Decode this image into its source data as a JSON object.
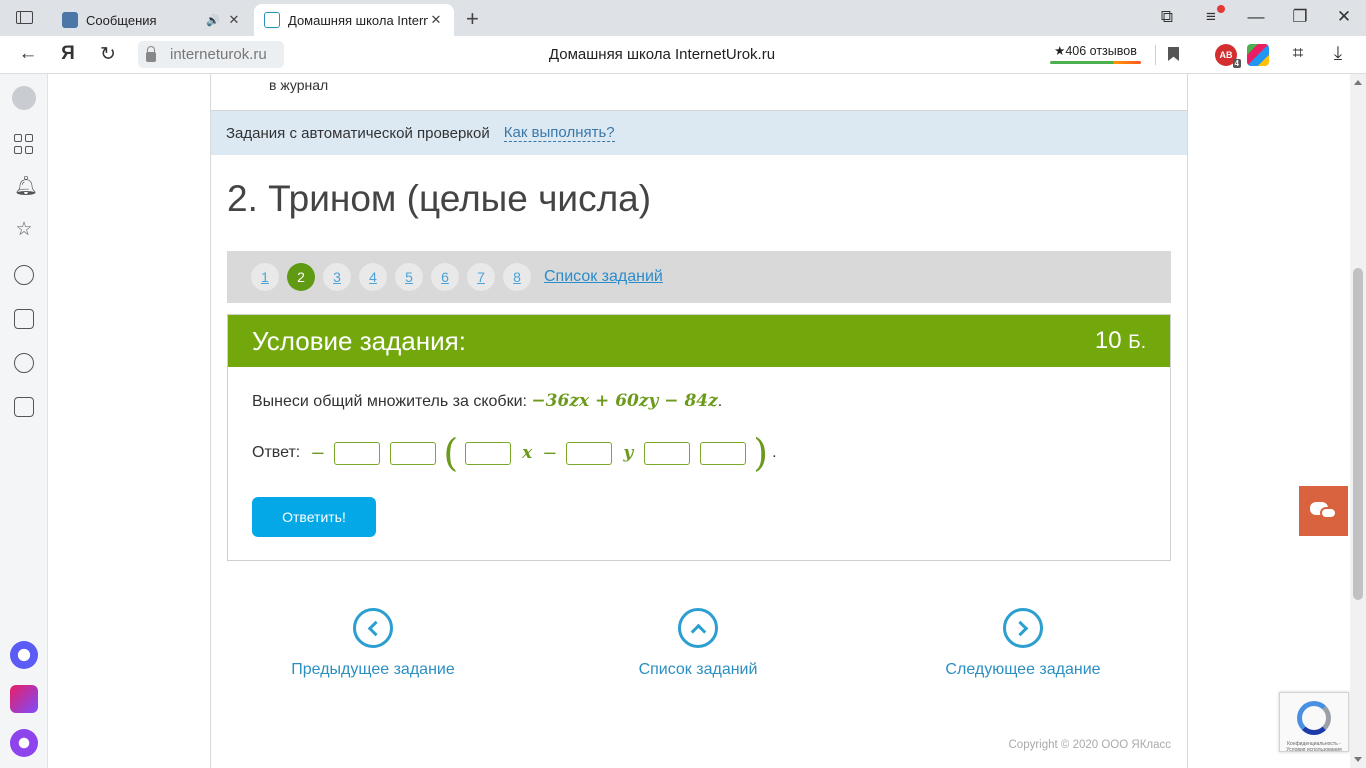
{
  "browser": {
    "tabs": [
      {
        "title": "Сообщения",
        "active": false,
        "playing_audio": true
      },
      {
        "title": "Домашняя школа Intern",
        "active": true,
        "playing_audio": false
      }
    ],
    "address": "interneturok.ru",
    "page_title": "Домашняя школа InternetUrok.ru",
    "reviews": "★406 отзывов",
    "yandex_letter": "Я",
    "extension_badge": "4"
  },
  "page": {
    "journal_text": "в журнал",
    "autocheck": {
      "label": "Задания с автоматической проверкой",
      "howto_link": "Как выполнять?"
    },
    "heading": "2. Трином (целые числа)",
    "pager": {
      "pages": [
        "1",
        "2",
        "3",
        "4",
        "5",
        "6",
        "7",
        "8"
      ],
      "active_index": 1,
      "list_link": "Список заданий"
    },
    "task": {
      "title": "Условие задания:",
      "points": "10",
      "points_unit": "Б.",
      "question": "Вынеси общий множитель за скобки: ",
      "expression": "−36zx + 60zy − 84z",
      "expression_end": ".",
      "answer_label": "Ответ:",
      "answer_minus": "−",
      "answer_var_x": "x",
      "answer_minus2": "−",
      "answer_var_y": "y",
      "answer_end": ".",
      "inputs": [
        "",
        "",
        "",
        "",
        "",
        ""
      ],
      "submit": "Ответить!"
    },
    "nav": {
      "prev": "Предыдущее задание",
      "list": "Список заданий",
      "next": "Следующее задание"
    },
    "copyright": "Copyright © 2020 ООО ЯКласс",
    "recaptcha_text": "Конфиденциальность - Условия использования"
  },
  "colors": {
    "task_header": "#73a80c",
    "active_page": "#5f9a12",
    "submit": "#04a8e6",
    "chat": "#d9633f",
    "link": "#2b8fc2"
  }
}
